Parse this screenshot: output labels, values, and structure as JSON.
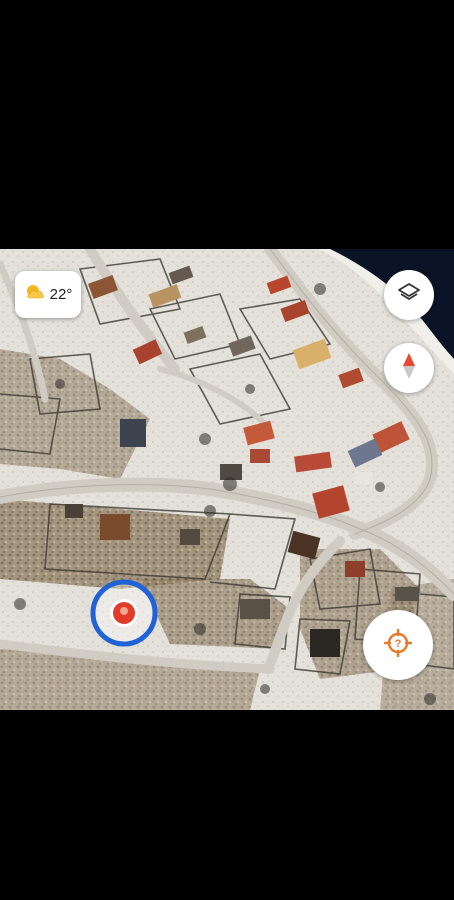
{
  "map": {
    "view": "satellite",
    "season": "winter"
  },
  "weather": {
    "icon": "partly-cloudy-icon",
    "temperature": "22°"
  },
  "controls": {
    "layers_icon": "layers-icon",
    "compass_icon": "compass-icon",
    "locate_icon": "my-location-icon"
  },
  "marker": {
    "icon": "current-location-marker"
  },
  "colors": {
    "snow": "#e8e6e1",
    "road": "#cfcac2",
    "water": "#0b1426",
    "marker_ring": "#1f63d6",
    "marker_center": "#e23b2a",
    "compass_red": "#e8492f",
    "locate_orange": "#e7792b",
    "weather_sun": "#f4b81e"
  }
}
